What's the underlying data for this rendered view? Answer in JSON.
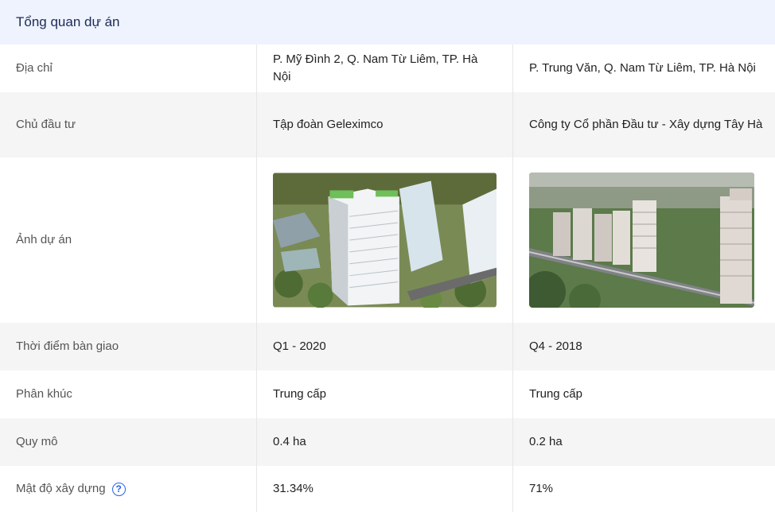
{
  "header": {
    "title": "Tổng quan dự án"
  },
  "rows": {
    "address": {
      "label": "Địa chỉ",
      "p1": "P. Mỹ Đình 2, Q. Nam Từ Liêm, TP. Hà Nội",
      "p2": "P. Trung Văn, Q. Nam Từ Liêm, TP. Hà Nội"
    },
    "investor": {
      "label": "Chủ đầu tư",
      "p1": "Tập đoàn Geleximco",
      "p2": "Công ty Cổ phần Đầu tư - Xây dựng Tây Hà"
    },
    "image": {
      "label": "Ảnh dự án"
    },
    "handover": {
      "label": "Thời điểm bàn giao",
      "p1": "Q1 - 2020",
      "p2": "Q4 - 2018"
    },
    "segment": {
      "label": "Phân khúc",
      "p1": "Trung cấp",
      "p2": "Trung cấp"
    },
    "scale": {
      "label": "Quy mô",
      "p1": "0.4 ha",
      "p2": "0.2 ha"
    },
    "density": {
      "label": "Mật độ xây dựng",
      "p1": "31.34%",
      "p2": "71%",
      "help_icon": "question-circle-icon"
    }
  },
  "colors": {
    "header_bg": "#eef3fd",
    "alt_row": "#f5f5f5",
    "accent": "#2563eb"
  }
}
